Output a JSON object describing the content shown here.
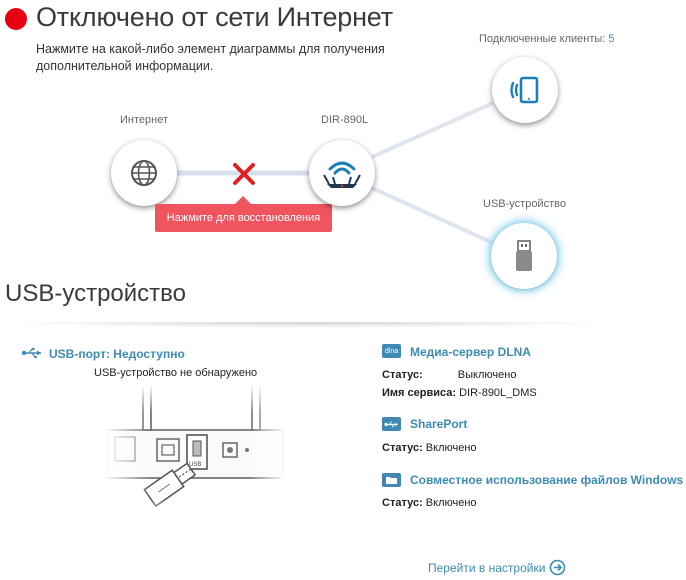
{
  "header": {
    "title": "Отключено от сети Интернет",
    "hint": "Нажмите на какой-либо элемент диаграммы для получения дополнительной информации.",
    "status_color": "#e60012"
  },
  "diagram": {
    "internet_label": "Интернет",
    "router_label": "DIR-890L",
    "clients_label": "Подключенные клиенты:",
    "clients_count": "5",
    "usb_label": "USB-устройство",
    "restore_tooltip": "Нажмите для восстановления",
    "icons": [
      "globe-icon",
      "router-icon",
      "tablet-icon",
      "usb-stick-icon",
      "disconnected-x-icon"
    ]
  },
  "usb_section": {
    "title": "USB-устройство",
    "port_label": "USB-порт: Недоступно",
    "not_found": "USB-устройство не обнаружено",
    "port_sticker": "USB"
  },
  "services": {
    "dlna": {
      "icon_text": "dlna",
      "title": "Медиа-сервер DLNA",
      "status_label": "Статус:",
      "status_value": "Выключено",
      "service_name_label": "Имя сервиса:",
      "service_name_value": "DIR-890L_DMS"
    },
    "shareport": {
      "title": "SharePort",
      "status_label": "Статус:",
      "status_value": "Включено"
    },
    "windows_sharing": {
      "title": "Совместное использование файлов Windows",
      "status_label": "Статус:",
      "status_value": "Включено"
    }
  },
  "footer": {
    "settings_link": "Перейти в настройки"
  },
  "colors": {
    "accent": "#3d8bb3",
    "tooltip": "#f0545e",
    "error": "#e02020",
    "line": "#d5dcea"
  }
}
